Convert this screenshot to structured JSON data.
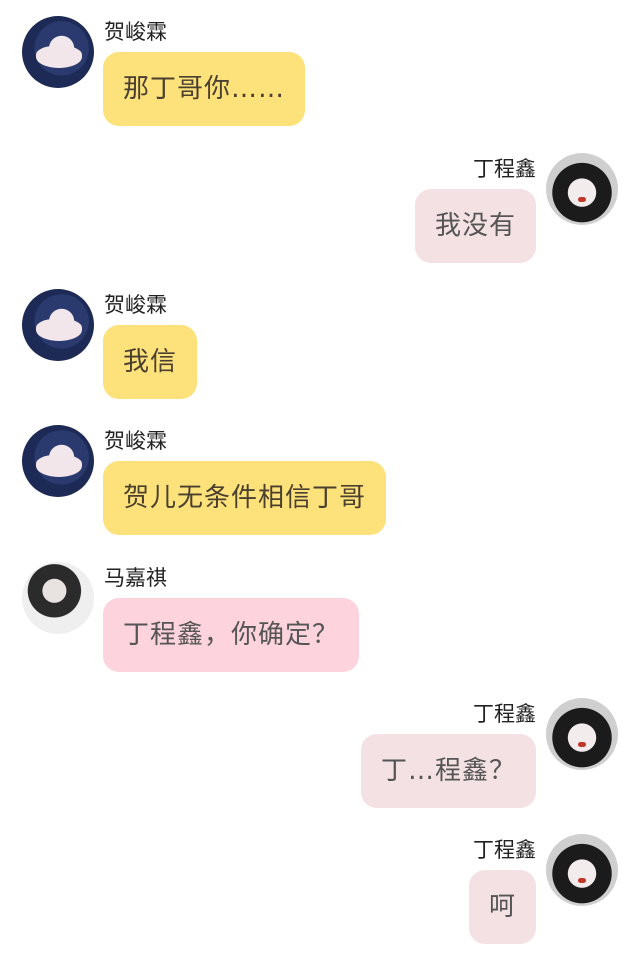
{
  "messages": [
    {
      "side": "left",
      "sender": "贺峻霖",
      "avatar": "avatar-he",
      "bubble_color": "yellow",
      "text": "那丁哥你……"
    },
    {
      "side": "right",
      "sender": "丁程鑫",
      "avatar": "avatar-ding",
      "bubble_color": "mauve",
      "text": "我没有"
    },
    {
      "side": "left",
      "sender": "贺峻霖",
      "avatar": "avatar-he",
      "bubble_color": "yellow",
      "text": "我信"
    },
    {
      "side": "left",
      "sender": "贺峻霖",
      "avatar": "avatar-he",
      "bubble_color": "yellow",
      "text": "贺儿无条件相信丁哥"
    },
    {
      "side": "left",
      "sender": "马嘉祺",
      "avatar": "avatar-ma",
      "bubble_color": "pink",
      "text": "丁程鑫，你确定？"
    },
    {
      "side": "right",
      "sender": "丁程鑫",
      "avatar": "avatar-ding",
      "bubble_color": "mauve",
      "text": "丁…程鑫？"
    },
    {
      "side": "right",
      "sender": "丁程鑫",
      "avatar": "avatar-ding",
      "bubble_color": "mauve",
      "text": "呵"
    }
  ],
  "colors": {
    "yellow": "#fde17a",
    "pink": "#fdd3dd",
    "mauve": "#f4e1e3",
    "background": "#ffffff"
  }
}
